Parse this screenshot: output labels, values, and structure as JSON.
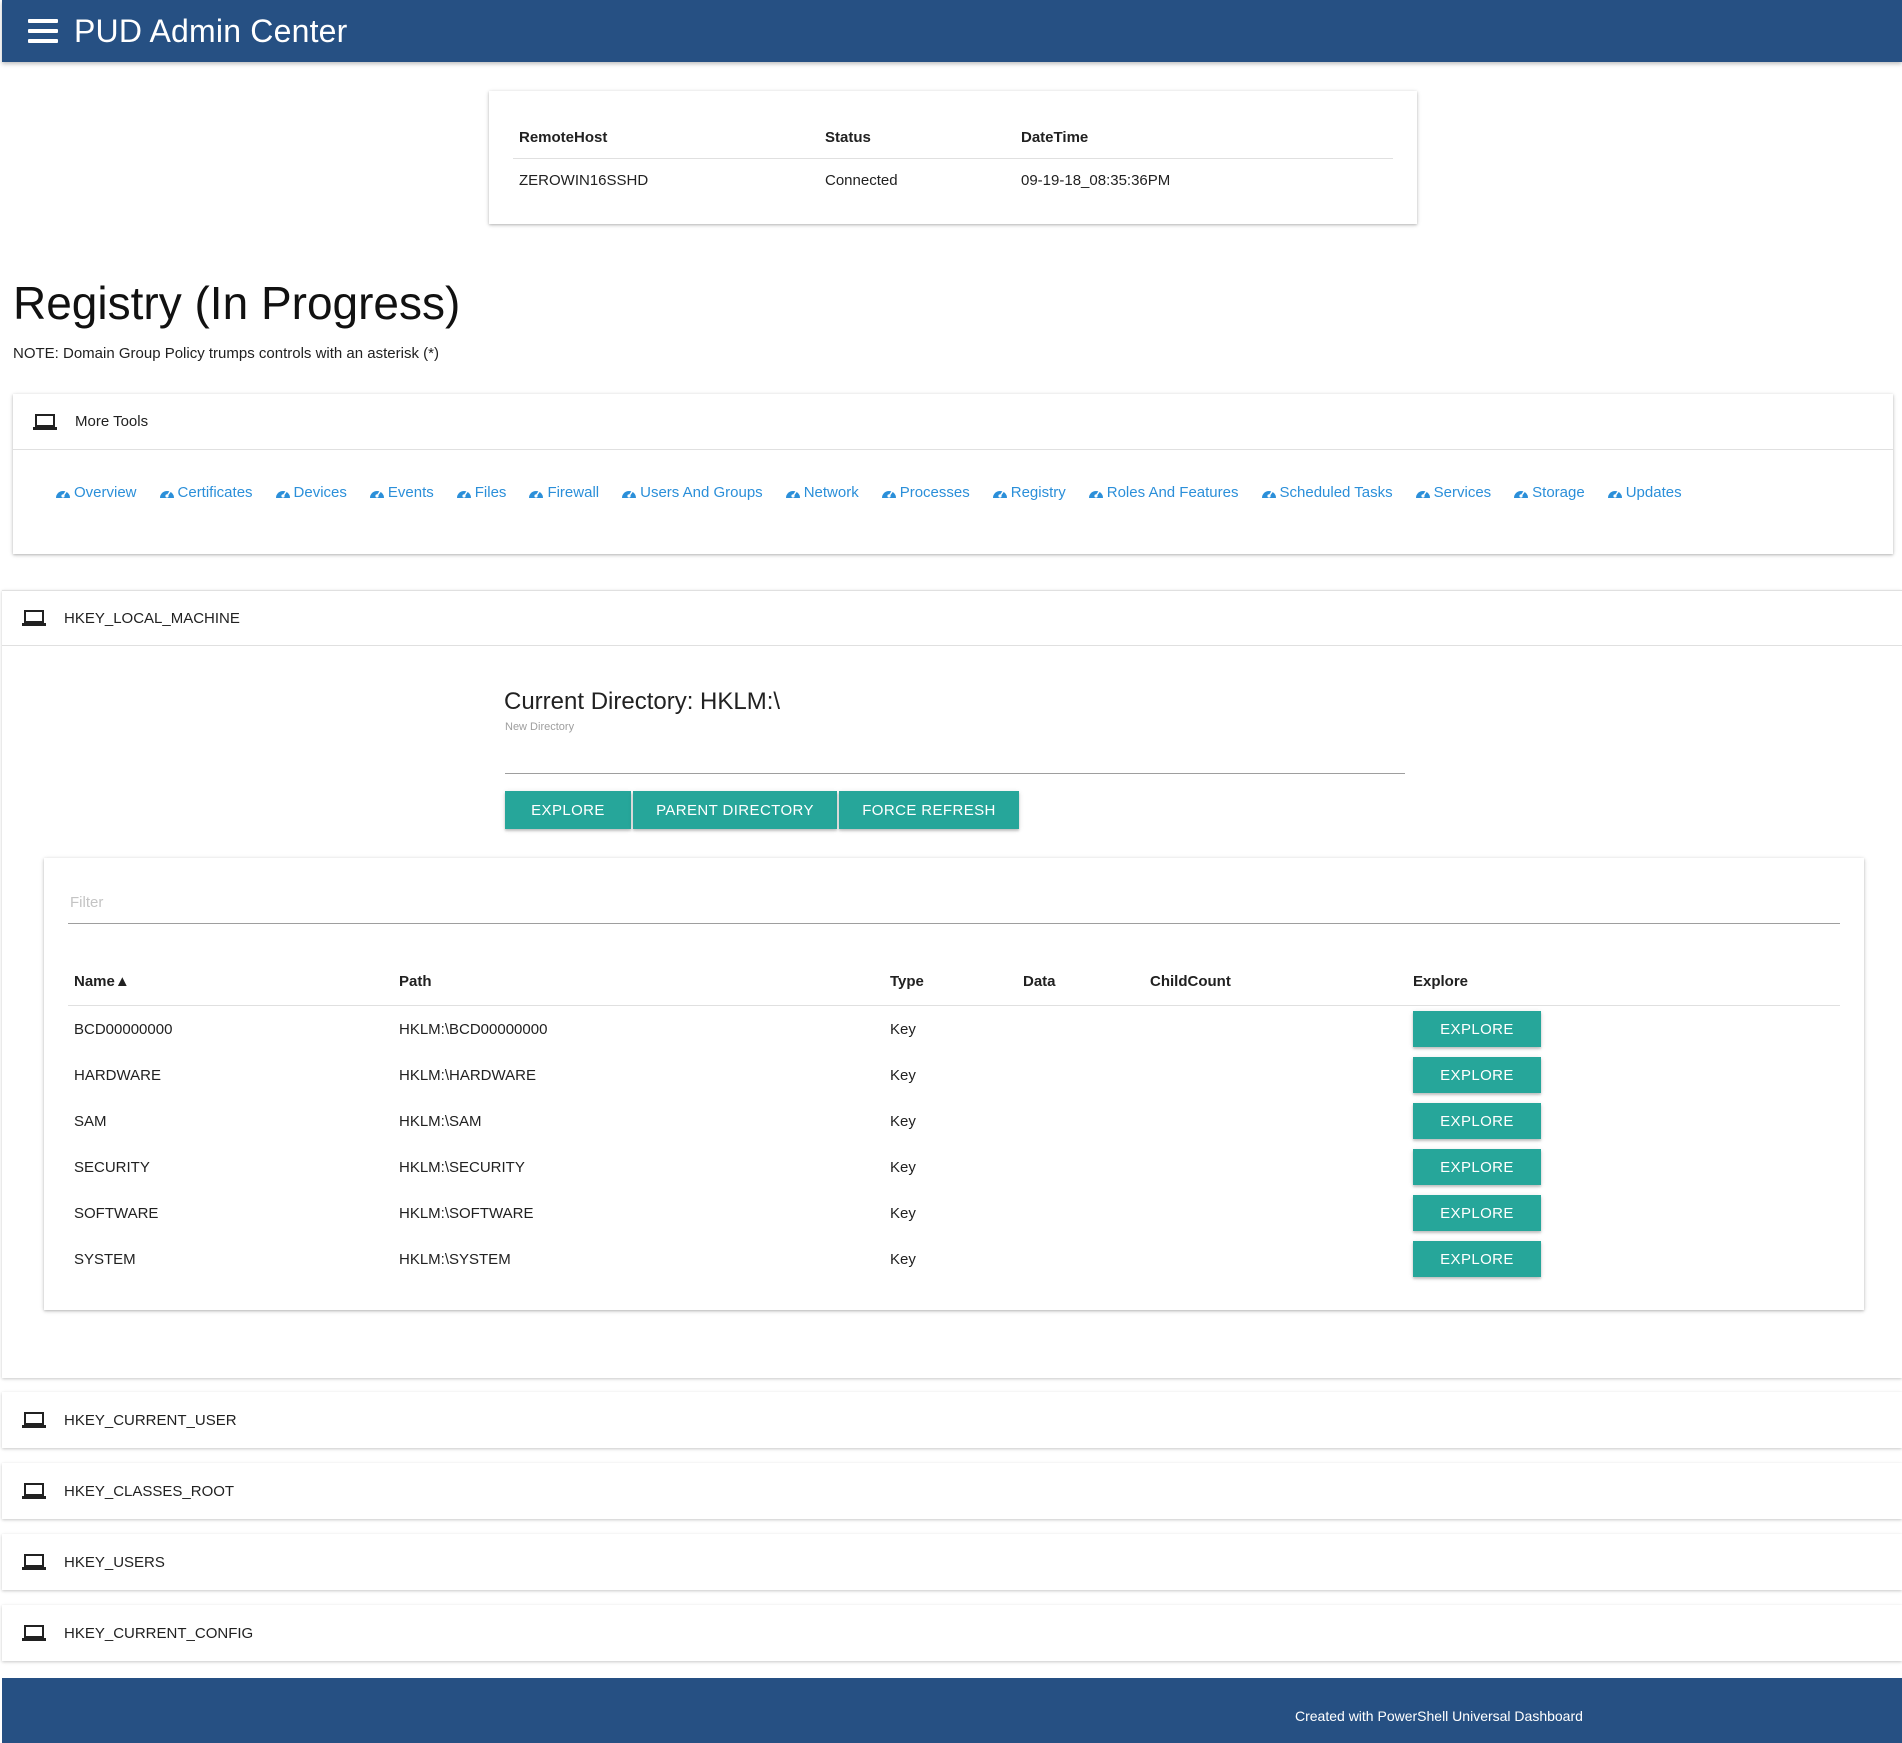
{
  "app": {
    "title": "PUD Admin Center"
  },
  "host_table": {
    "headers": [
      "RemoteHost",
      "Status",
      "DateTime"
    ],
    "rows": [
      [
        "ZEROWIN16SSHD",
        "Connected",
        "09-19-18_08:35:36PM"
      ]
    ]
  },
  "page": {
    "title": "Registry (In Progress)",
    "note": "NOTE: Domain Group Policy trumps controls with an asterisk (*)"
  },
  "tools": {
    "title": "More Tools",
    "links": [
      "Overview",
      "Certificates",
      "Devices",
      "Events",
      "Files",
      "Firewall",
      "Users And Groups",
      "Network",
      "Processes",
      "Registry",
      "Roles And Features",
      "Scheduled Tasks",
      "Services",
      "Storage",
      "Updates"
    ]
  },
  "hives": {
    "hklm": {
      "label": "HKEY_LOCAL_MACHINE",
      "current_directory": "Current Directory: HKLM:\\",
      "new_dir_label": "New Directory",
      "new_dir_value": "",
      "buttons": {
        "explore": "EXPLORE",
        "parent": "PARENT DIRECTORY",
        "refresh": "FORCE REFRESH"
      },
      "filter_placeholder": "Filter",
      "table": {
        "headers": [
          "Name▲",
          "Path",
          "Type",
          "Data",
          "ChildCount",
          "Explore"
        ],
        "rows": [
          {
            "name": "BCD00000000",
            "path": "HKLM:\\BCD00000000",
            "type": "Key",
            "data": "",
            "childcount": "",
            "explore": "EXPLORE"
          },
          {
            "name": "HARDWARE",
            "path": "HKLM:\\HARDWARE",
            "type": "Key",
            "data": "",
            "childcount": "",
            "explore": "EXPLORE"
          },
          {
            "name": "SAM",
            "path": "HKLM:\\SAM",
            "type": "Key",
            "data": "",
            "childcount": "",
            "explore": "EXPLORE"
          },
          {
            "name": "SECURITY",
            "path": "HKLM:\\SECURITY",
            "type": "Key",
            "data": "",
            "childcount": "",
            "explore": "EXPLORE"
          },
          {
            "name": "SOFTWARE",
            "path": "HKLM:\\SOFTWARE",
            "type": "Key",
            "data": "",
            "childcount": "",
            "explore": "EXPLORE"
          },
          {
            "name": "SYSTEM",
            "path": "HKLM:\\SYSTEM",
            "type": "Key",
            "data": "",
            "childcount": "",
            "explore": "EXPLORE"
          }
        ]
      }
    },
    "hkcu": {
      "label": "HKEY_CURRENT_USER"
    },
    "hkcr": {
      "label": "HKEY_CLASSES_ROOT"
    },
    "hku": {
      "label": "HKEY_USERS"
    },
    "hkcc": {
      "label": "HKEY_CURRENT_CONFIG"
    }
  },
  "footer": {
    "text": "Created with PowerShell Universal Dashboard"
  },
  "colors": {
    "header": "#265083",
    "accent": "#26a69a",
    "link": "#2b8fd9"
  },
  "icons": {
    "menu": "hamburger-icon",
    "section": "laptop-icon",
    "tool_link": "dashboard-gauge-icon"
  }
}
